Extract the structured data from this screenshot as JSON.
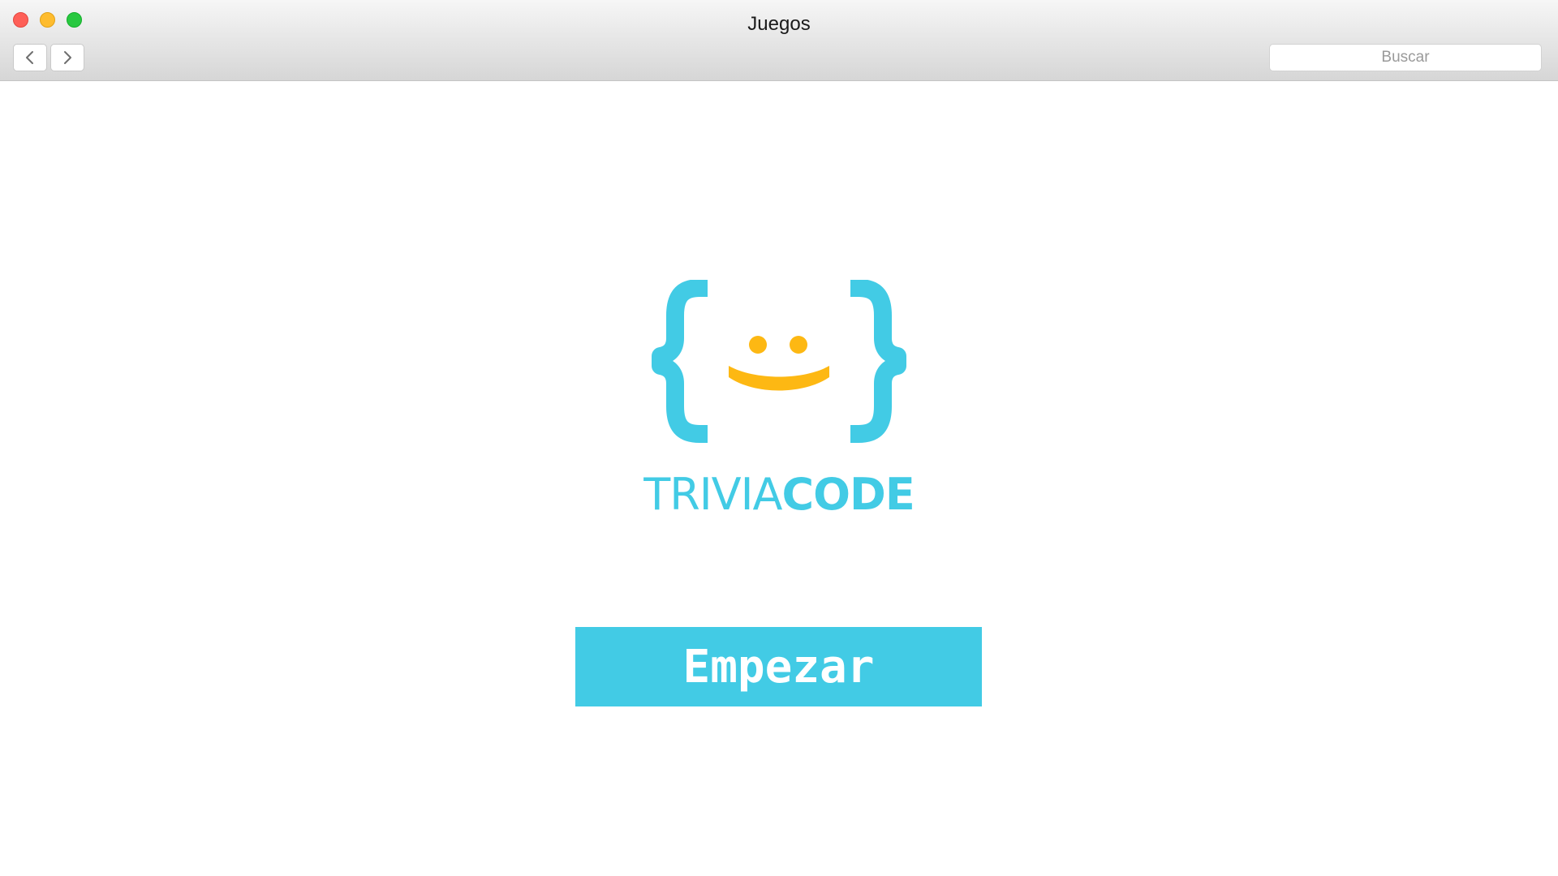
{
  "window": {
    "title": "Juegos"
  },
  "toolbar": {
    "back_icon": "chevron-left-icon",
    "forward_icon": "chevron-right-icon",
    "search_placeholder": "Buscar"
  },
  "brand": {
    "name_light": "TRIVIA",
    "name_bold": "CODE",
    "primary_color": "#42cbe5",
    "accent_color": "#fdb813"
  },
  "main": {
    "start_label": "Empezar"
  }
}
